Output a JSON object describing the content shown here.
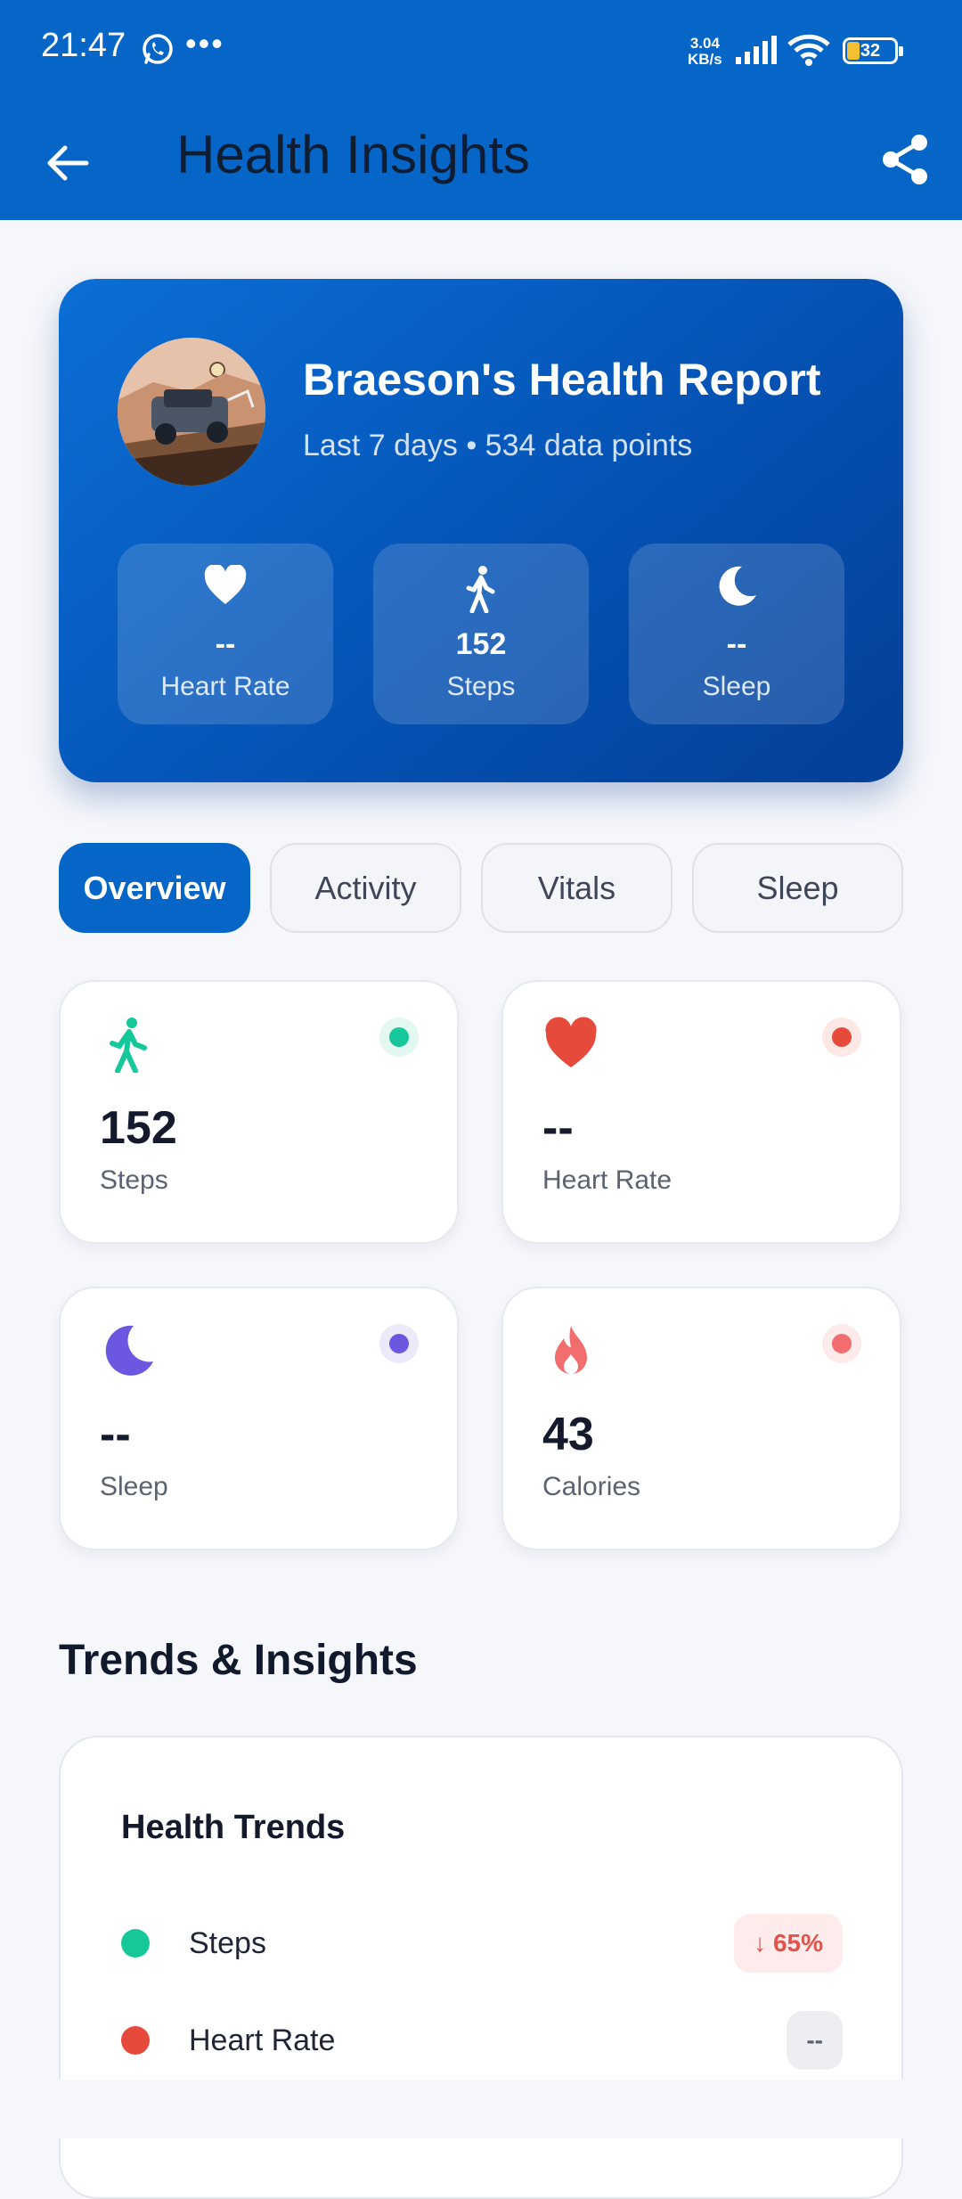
{
  "status_bar": {
    "time": "21:47",
    "dots": "•••",
    "speed_value": "3.04",
    "speed_unit": "KB/s",
    "battery": "32"
  },
  "app_bar": {
    "title": "Health Insights",
    "back_icon": "arrow-left-icon",
    "share_icon": "share-icon"
  },
  "profile": {
    "title": "Braeson's Health Report",
    "subtitle": "Last 7 days • 534 data points",
    "stats": [
      {
        "icon": "heart-icon",
        "value": "--",
        "label": "Heart Rate"
      },
      {
        "icon": "walk-icon",
        "value": "152",
        "label": "Steps"
      },
      {
        "icon": "moon-icon",
        "value": "--",
        "label": "Sleep"
      }
    ]
  },
  "tabs": [
    {
      "label": "Overview",
      "active": true
    },
    {
      "label": "Activity",
      "active": false
    },
    {
      "label": "Vitals",
      "active": false
    },
    {
      "label": "Sleep",
      "active": false
    }
  ],
  "metrics": [
    {
      "icon": "walk-icon",
      "value": "152",
      "label": "Steps",
      "color": "#16c79a"
    },
    {
      "icon": "heart-icon",
      "value": "--",
      "label": "Heart Rate",
      "color": "#e64a3b"
    },
    {
      "icon": "moon-icon",
      "value": "--",
      "label": "Sleep",
      "color": "#6b57e0"
    },
    {
      "icon": "fire-icon",
      "value": "43",
      "label": "Calories",
      "color": "#f26d6d"
    }
  ],
  "section_title": "Trends & Insights",
  "trends": {
    "title": "Health Trends",
    "rows": [
      {
        "name": "Steps",
        "badge": "↓ 65%",
        "dot_color": "#16c79a",
        "badge_bg": "#fdeceb",
        "badge_color": "#e0524a"
      },
      {
        "name": "Heart Rate",
        "badge": "--",
        "dot_color": "#e64a3b",
        "badge_bg": "#eceef2",
        "badge_color": "#5c6270"
      }
    ]
  },
  "colors": {
    "primary": "#0566c8",
    "background": "#f6f7fb"
  }
}
